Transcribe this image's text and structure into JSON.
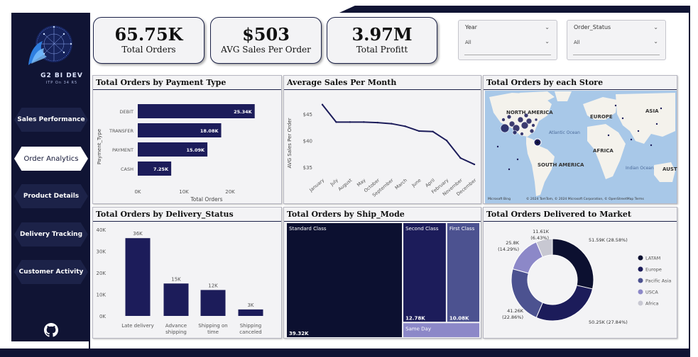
{
  "brand": {
    "name": "G2 BI DEV",
    "tagline": "ITP On 34 R5"
  },
  "nav": {
    "items": [
      {
        "label": "Sales Performance"
      },
      {
        "label": "Order Analytics"
      },
      {
        "label": "Product Details"
      },
      {
        "label": "Delivery Tracking"
      },
      {
        "label": "Customer Activity"
      }
    ],
    "active_index": 1
  },
  "kpis": [
    {
      "value": "65.75K",
      "label": "Total Orders"
    },
    {
      "value": "$503",
      "label": "AVG Sales Per Order"
    },
    {
      "value": "3.97M",
      "label": "Total Profitt"
    }
  ],
  "slicers": [
    {
      "title": "Year",
      "value": "All"
    },
    {
      "title": "Order_Status",
      "value": "All"
    }
  ],
  "panels": {
    "payment": "Total Orders by Payment Type",
    "avg_sales": "Average Sales Per Month",
    "store": "Total Orders by each Store",
    "delivery": "Total Orders by Delivery_Status",
    "ship_mode": "Total Orders by Ship_Mode",
    "market": "Total Orders Delivered to Market"
  },
  "map": {
    "labels": [
      "NORTH AMERICA",
      "EUROPE",
      "ASIA",
      "AFRICA",
      "SOUTH AMERICA",
      "Atlantic Ocean",
      "Indian Ocean",
      "AUST"
    ],
    "attribution": "© 2024 TomTom, © 2024 Microsoft Corporation, © OpenStreetMap  Terms",
    "logo": "Microsoft Bing"
  },
  "chart_data": [
    {
      "type": "bar",
      "orientation": "horizontal",
      "categories": [
        "DEBIT",
        "TRANSFER",
        "PAYMENT",
        "CASH"
      ],
      "values": [
        25340,
        18080,
        15090,
        7250
      ],
      "data_labels": [
        "25.34K",
        "18.08K",
        "15.09K",
        "7.25K"
      ],
      "xlabel": "Total Orders",
      "ylabel": "Payment_Type",
      "xticks": [
        "0K",
        "10K",
        "20K"
      ],
      "xlim": [
        0,
        30000
      ],
      "bar_color": "#1c1c5a"
    },
    {
      "type": "line",
      "categories": [
        "January",
        "July",
        "August",
        "May",
        "October",
        "September",
        "March",
        "June",
        "April",
        "February",
        "November",
        "December"
      ],
      "values": [
        46.8,
        43.5,
        43.5,
        43.5,
        43.4,
        43.2,
        42.7,
        41.8,
        41.7,
        40.0,
        36.7,
        35.5
      ],
      "ylabel": "AVG Sales Per Order",
      "yticks": [
        "$35",
        "$40",
        "$45"
      ],
      "ylim": [
        33.5,
        48.5
      ],
      "line_color": "#1c1c5a"
    },
    {
      "type": "bar",
      "categories": [
        "Late delivery",
        "Advance shipping",
        "Shipping on time",
        "Shipping canceled"
      ],
      "values": [
        36000,
        15000,
        12000,
        3000
      ],
      "data_labels": [
        "36K",
        "15K",
        "12K",
        "3K"
      ],
      "yticks": [
        "0K",
        "10K",
        "20K",
        "30K",
        "40K"
      ],
      "ylim": [
        0,
        40000
      ],
      "bar_color": "#1c1c5a"
    },
    {
      "type": "treemap",
      "items": [
        {
          "name": "Standard Class",
          "value": 39320,
          "label": "39.32K",
          "color": "#0c1030"
        },
        {
          "name": "Second Class",
          "value": 12780,
          "label": "12.78K",
          "color": "#1c1c5a"
        },
        {
          "name": "First Class",
          "value": 10080,
          "label": "10.08K",
          "color": "#4c5290"
        },
        {
          "name": "Same Day",
          "value": 3570,
          "label": "",
          "color": "#8c88c8"
        }
      ]
    },
    {
      "type": "pie",
      "style": "donut",
      "slices": [
        {
          "name": "LATAM",
          "value": 51590,
          "label": "51.59K (28.58%)",
          "color": "#0c1030"
        },
        {
          "name": "Europe",
          "value": 50250,
          "label": "50.25K (27.84%)",
          "color": "#1c1c5a"
        },
        {
          "name": "Pacific Asia",
          "value": 41260,
          "label": "41.26K (22.86%)",
          "color": "#4c5290"
        },
        {
          "name": "USCA",
          "value": 25800,
          "label": "25.8K (14.29%)",
          "color": "#8c88c8"
        },
        {
          "name": "Africa",
          "value": 11610,
          "label": "11.61K (6.43%)",
          "color": "#c8c8d2"
        }
      ]
    }
  ]
}
